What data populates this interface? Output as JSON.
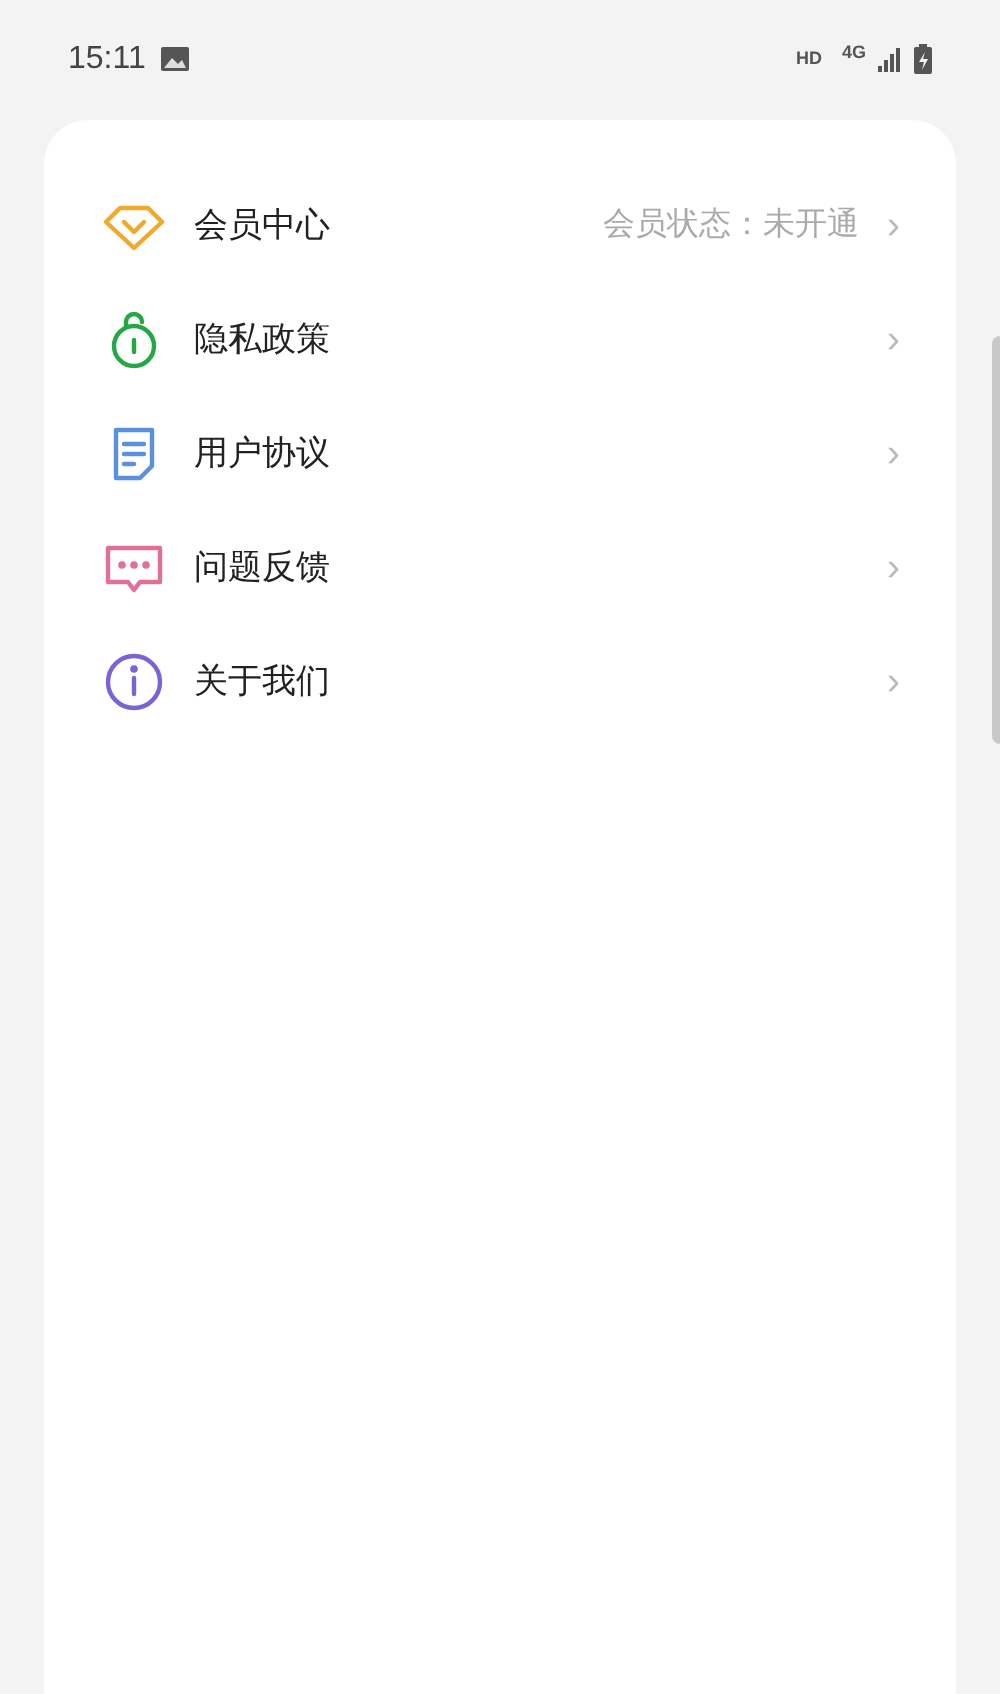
{
  "status_bar": {
    "time": "15:11",
    "hd": "HD",
    "network": "4G"
  },
  "menu": [
    {
      "kind": "vip",
      "label": "会员中心",
      "value": "会员状态：未开通",
      "chevron": "›"
    },
    {
      "kind": "privacy",
      "label": "隐私政策",
      "chevron": "›"
    },
    {
      "kind": "agreement",
      "label": "用户协议",
      "chevron": "›"
    },
    {
      "kind": "feedback",
      "label": "问题反馈",
      "chevron": "›"
    },
    {
      "kind": "about",
      "label": "关于我们",
      "chevron": "›"
    }
  ]
}
